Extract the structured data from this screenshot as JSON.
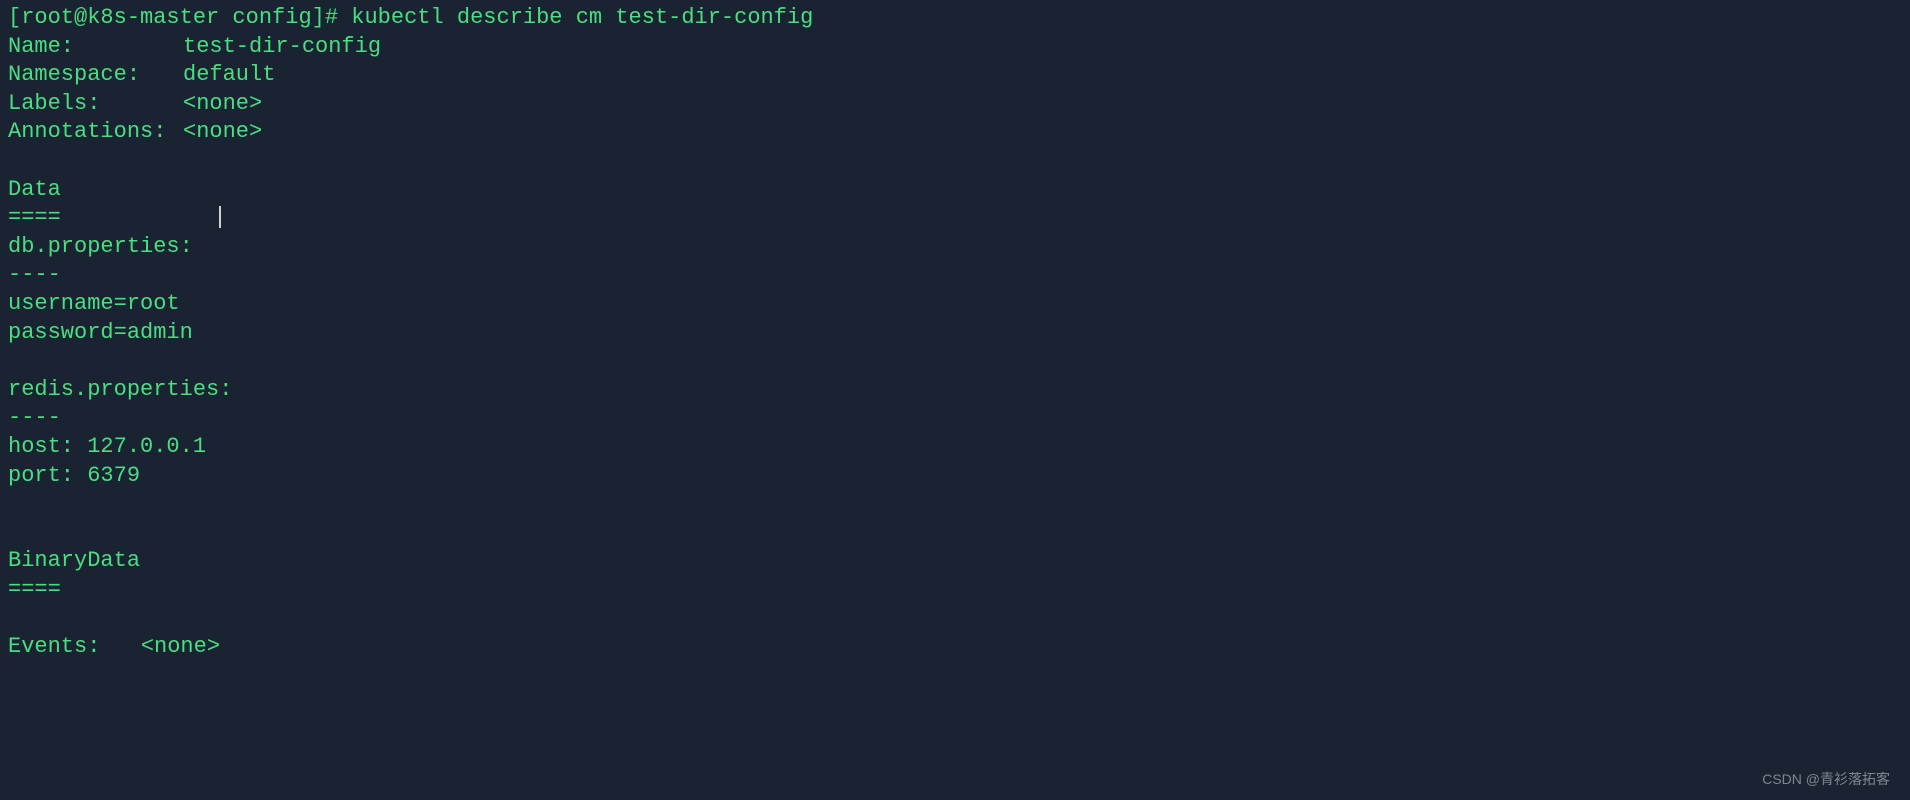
{
  "prompt": {
    "prefix": "[root@k8s-master config]# ",
    "command": "kubectl describe cm test-dir-config"
  },
  "fields": {
    "name_label": "Name:",
    "name_value": "test-dir-config",
    "namespace_label": "Namespace:",
    "namespace_value": "default",
    "labels_label": "Labels:",
    "labels_value": "<none>",
    "annotations_label": "Annotations:",
    "annotations_value": "<none>"
  },
  "data_section": {
    "header": "Data",
    "separator": "====",
    "entry1_key": "db.properties:",
    "entry_sep": "----",
    "entry1_line1": "username=root",
    "entry1_line2": "password=admin",
    "entry2_key": "redis.properties:",
    "entry2_line1": "host: 127.0.0.1",
    "entry2_line2": "port: 6379"
  },
  "binary_section": {
    "header": "BinaryData",
    "separator": "===="
  },
  "events": {
    "label": "Events:",
    "value": "<none>"
  },
  "watermark": "CSDN @青衫落拓客"
}
